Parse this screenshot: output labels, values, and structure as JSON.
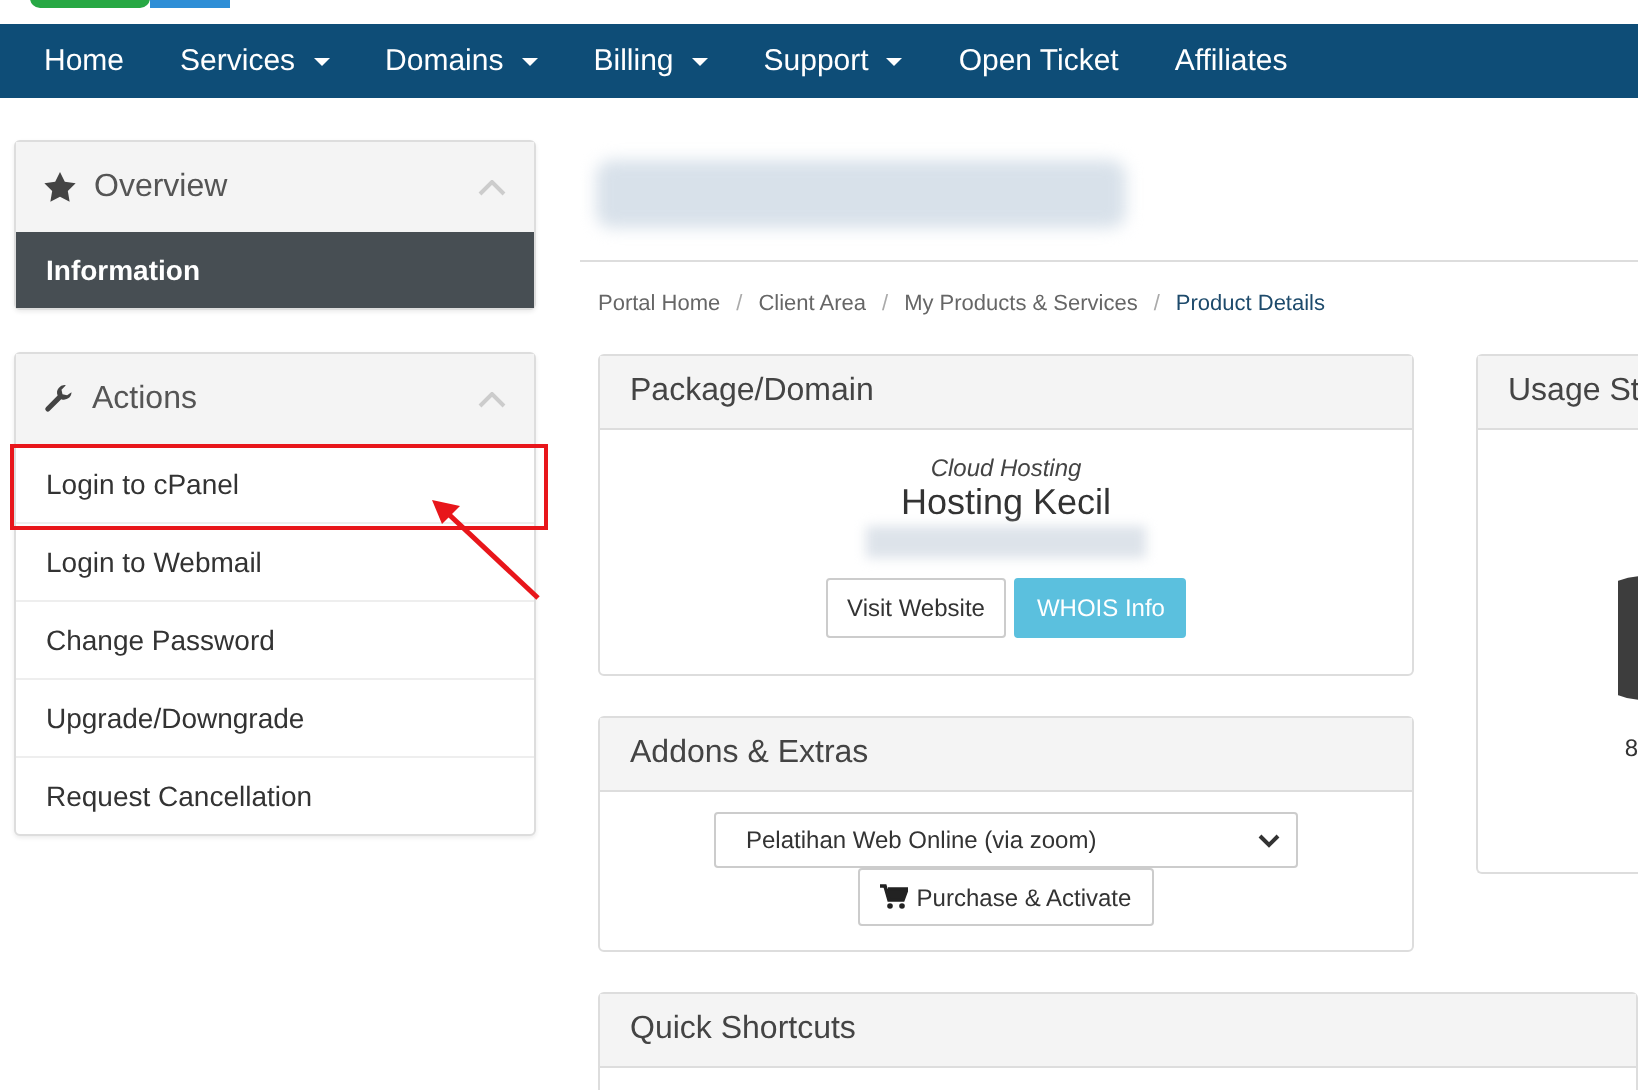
{
  "nav": [
    {
      "label": "Home",
      "dropdown": false
    },
    {
      "label": "Services",
      "dropdown": true
    },
    {
      "label": "Domains",
      "dropdown": true
    },
    {
      "label": "Billing",
      "dropdown": true
    },
    {
      "label": "Support",
      "dropdown": true
    },
    {
      "label": "Open Ticket",
      "dropdown": false
    },
    {
      "label": "Affiliates",
      "dropdown": false
    }
  ],
  "sidebar": {
    "overview": {
      "title": "Overview",
      "items": [
        {
          "label": "Information",
          "selected": true
        }
      ]
    },
    "actions": {
      "title": "Actions",
      "items": [
        {
          "label": "Login to cPanel",
          "highlighted": true
        },
        {
          "label": "Login to Webmail",
          "highlighted": false
        },
        {
          "label": "Change Password",
          "highlighted": false
        },
        {
          "label": "Upgrade/Downgrade",
          "highlighted": false
        },
        {
          "label": "Request Cancellation",
          "highlighted": false
        }
      ]
    }
  },
  "breadcrumb": [
    {
      "label": "Portal Home",
      "current": false
    },
    {
      "separator": "/",
      "label": "Client Area",
      "current": false
    },
    {
      "separator": "/",
      "label": "My Products & Services",
      "current": false
    },
    {
      "separator": "/",
      "label": "Product Details",
      "current": true
    }
  ],
  "package": {
    "title": "Package/Domain",
    "group": "Cloud Hosting",
    "product": "Hosting Kecil",
    "buttons": [
      {
        "label": "Visit Website",
        "kind": "default"
      },
      {
        "label": "WHOIS Info",
        "kind": "info"
      }
    ]
  },
  "addons": {
    "title": "Addons & Extras",
    "select": {
      "value": "Pelatihan Web Online (via zoom)"
    },
    "button": "Purchase & Activate"
  },
  "usage": {
    "title": "Usage St",
    "label": "8"
  },
  "shortcuts": {
    "title": "Quick Shortcuts"
  }
}
